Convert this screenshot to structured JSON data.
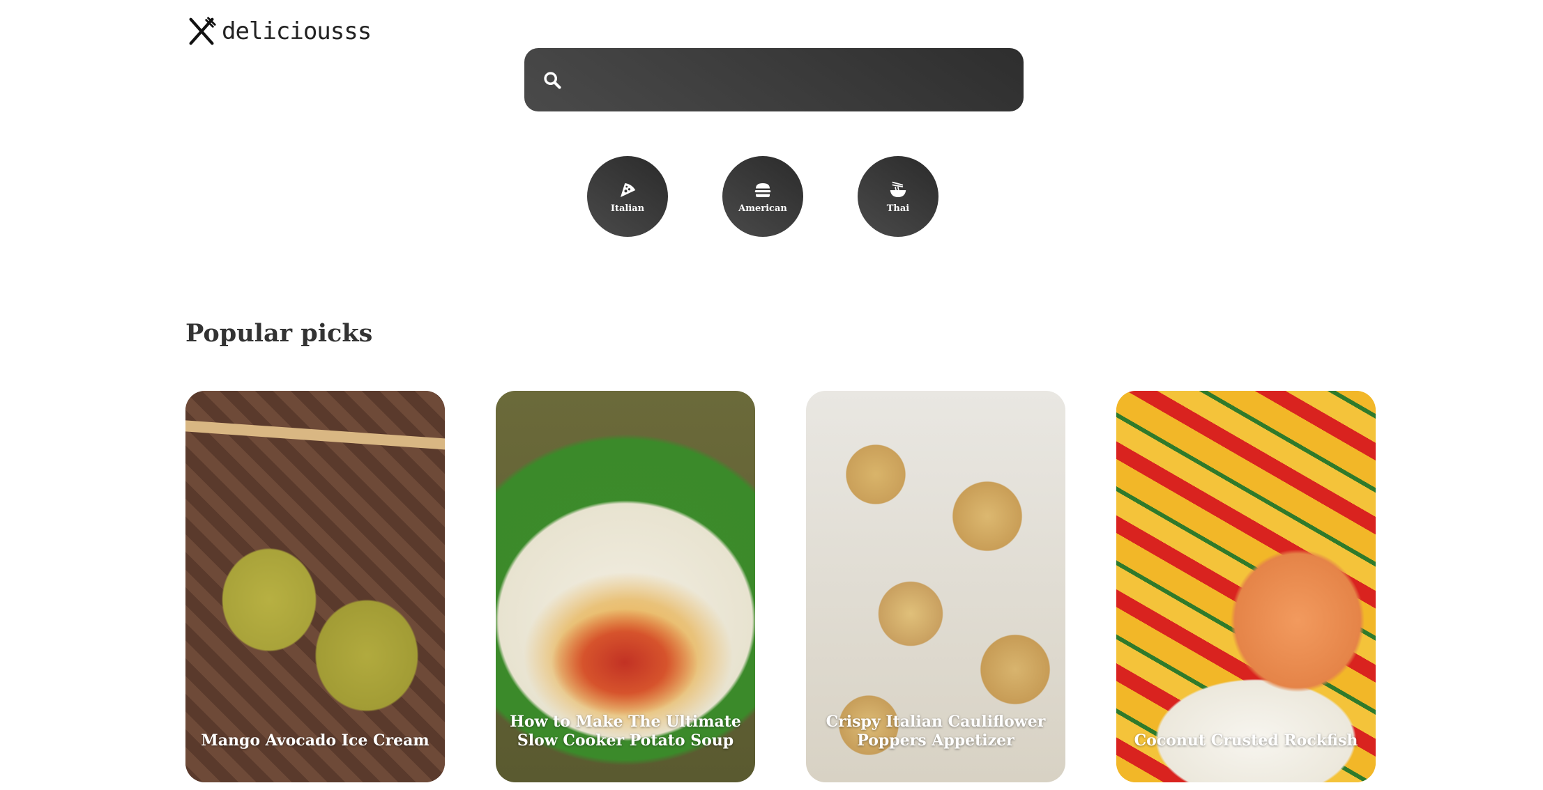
{
  "header": {
    "logo_text": "deliciousss",
    "logo_icon": "fork-knife-icon"
  },
  "search": {
    "placeholder": "",
    "value": "",
    "icon": "search-icon"
  },
  "cuisines": [
    {
      "label": "Italian",
      "icon": "pizza-icon"
    },
    {
      "label": "American",
      "icon": "burger-icon"
    },
    {
      "label": "Thai",
      "icon": "noodle-bowl-icon"
    }
  ],
  "popular": {
    "title": "Popular picks",
    "cards": [
      {
        "title": "Mango Avocado Ice Cream"
      },
      {
        "title": "How to Make The Ultimate Slow Cooker Potato Soup"
      },
      {
        "title": "Crispy Italian Cauliflower Poppers Appetizer"
      },
      {
        "title": "Coconut Crusted Rockfish"
      }
    ]
  },
  "colors": {
    "dark": "#333333",
    "background": "#ffffff",
    "text_on_dark": "#ffffff"
  }
}
